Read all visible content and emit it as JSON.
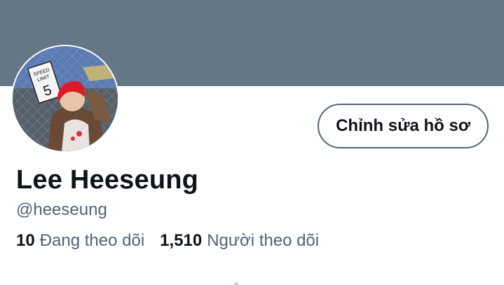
{
  "profile": {
    "display_name": "Lee Heeseung",
    "handle": "@heeseung",
    "edit_button_label": "Chỉnh sửa hồ sơ",
    "avatar": {
      "sign_line1": "SPEED",
      "sign_line2": "LIMIT",
      "sign_value": "5"
    }
  },
  "stats": {
    "following_count": "10",
    "following_label": "Đang theo dõi",
    "followers_count": "1,510",
    "followers_label": "Người theo dõi"
  },
  "colors": {
    "banner": "#657786",
    "text_primary": "#0f1419",
    "text_secondary": "#536471"
  }
}
